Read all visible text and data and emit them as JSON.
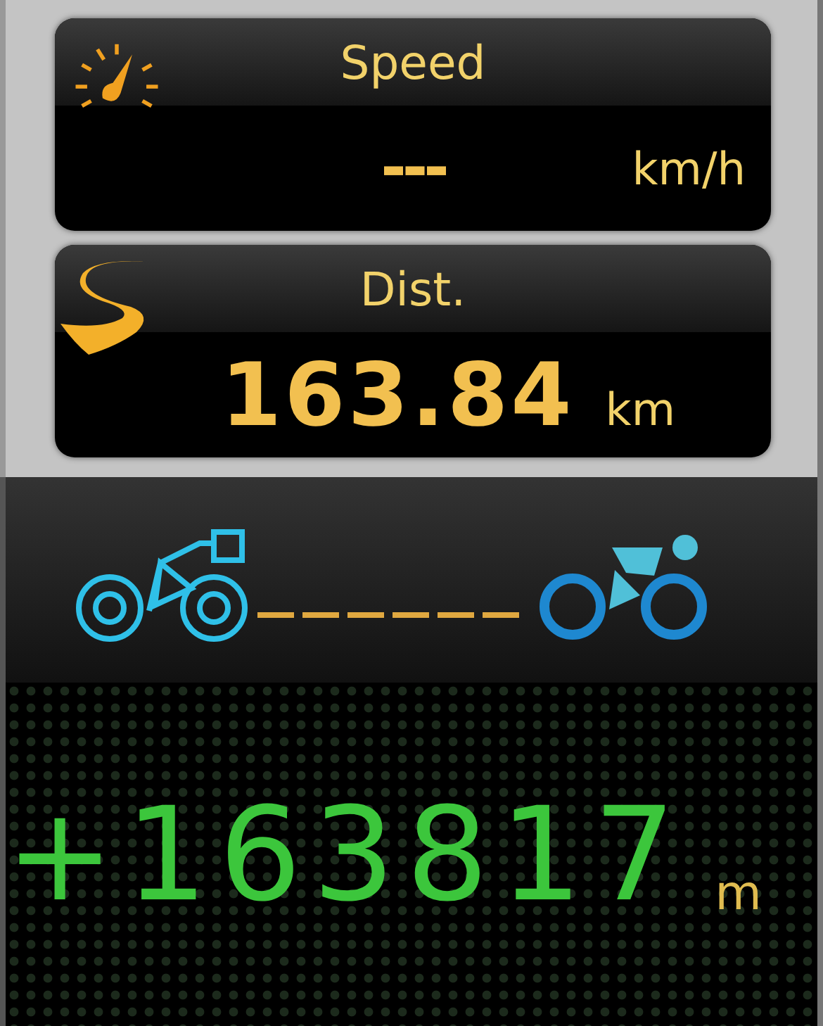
{
  "cards": [
    {
      "kind": "speed",
      "label": "Speed",
      "value": "---",
      "unit": "km/h"
    },
    {
      "kind": "distance",
      "label": "Dist.",
      "value": "163.84",
      "unit": "km"
    }
  ],
  "gap": {
    "value": "+163817",
    "unit": "m"
  }
}
